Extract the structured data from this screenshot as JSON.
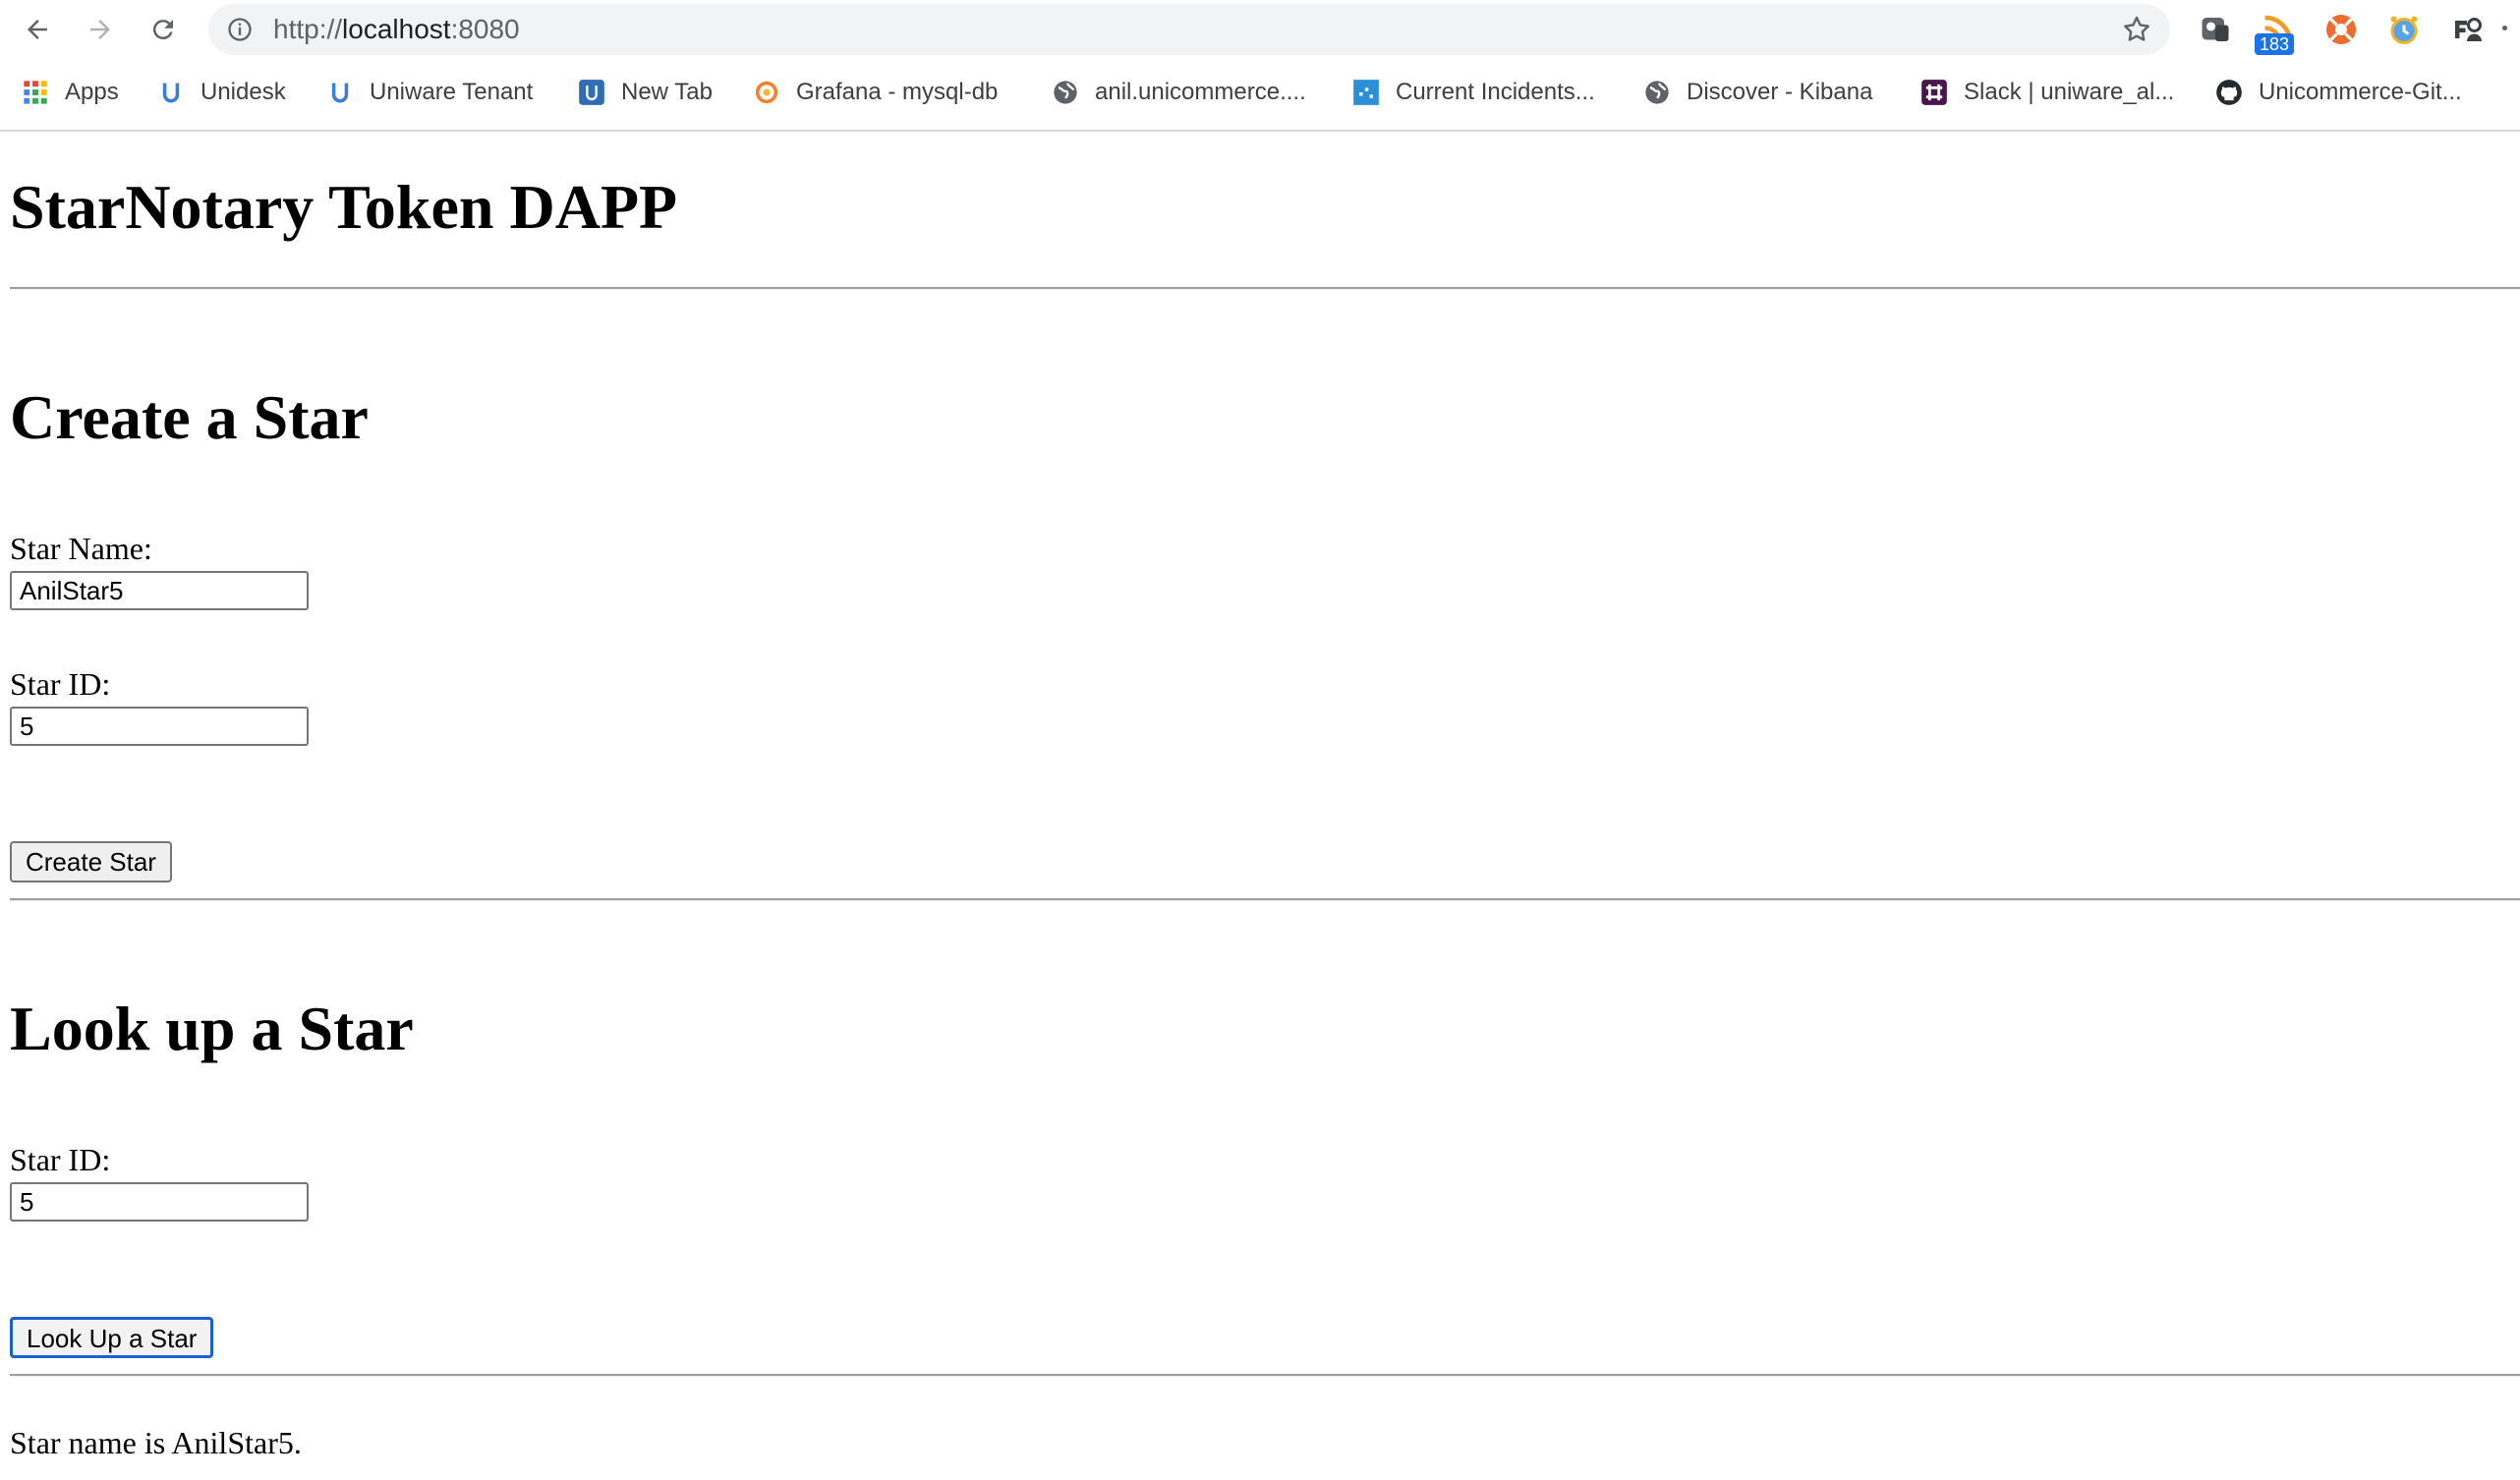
{
  "browser": {
    "url_scheme": "http://",
    "url_host": "localhost",
    "url_port": ":8080",
    "feed_badge": "183",
    "bookmarks": [
      {
        "label": "Apps"
      },
      {
        "label": "Unidesk"
      },
      {
        "label": "Uniware Tenant"
      },
      {
        "label": "New Tab"
      },
      {
        "label": "Grafana - mysql-db"
      },
      {
        "label": "anil.unicommerce...."
      },
      {
        "label": "Current Incidents..."
      },
      {
        "label": "Discover - Kibana"
      },
      {
        "label": "Slack | uniware_al..."
      },
      {
        "label": "Unicommerce-Git..."
      }
    ]
  },
  "page": {
    "title": "StarNotary Token DAPP",
    "create": {
      "heading": "Create a Star",
      "name_label": "Star Name:",
      "name_value": "AnilStar5",
      "id_label": "Star ID:",
      "id_value": "5",
      "button_label": "Create Star"
    },
    "lookup": {
      "heading": "Look up a Star",
      "id_label": "Star ID:",
      "id_value": "5",
      "button_label": "Look Up a Star"
    },
    "status_text": "Star name is AnilStar5."
  },
  "colors": {
    "apps_grid": [
      "#ea4335",
      "#fbbc04",
      "#34a853",
      "#4285f4"
    ],
    "focus_ring": "#1a5fd6"
  }
}
